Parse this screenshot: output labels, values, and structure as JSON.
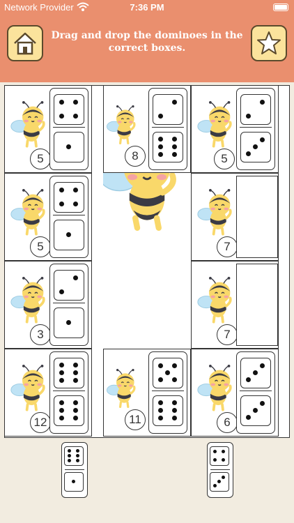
{
  "status_bar": {
    "carrier": "Network Provider",
    "time": "7:36 PM"
  },
  "header": {
    "instruction": "Drag and drop the dominoes in the correct boxes.",
    "home_icon": "home-icon",
    "star_icon": "star-icon",
    "colors": {
      "bar": "#ea8f6e",
      "button": "#fbe39c"
    }
  },
  "board": {
    "cells": [
      {
        "number": "5",
        "domino": [
          4,
          1
        ]
      },
      {
        "number": "8",
        "domino": [
          2,
          6
        ]
      },
      {
        "number": "5",
        "domino": [
          2,
          3
        ]
      },
      {
        "number": "5",
        "domino": [
          4,
          1
        ]
      },
      {
        "number": "7",
        "domino": null
      },
      {
        "number": "3",
        "domino": [
          2,
          1
        ]
      },
      {
        "number": "7",
        "domino": null
      },
      {
        "number": "12",
        "domino": [
          6,
          6
        ]
      },
      {
        "number": "11",
        "domino": [
          5,
          6
        ]
      },
      {
        "number": "6",
        "domino": [
          3,
          3
        ]
      }
    ]
  },
  "tray": [
    {
      "domino": [
        6,
        1
      ]
    },
    {
      "domino": [
        4,
        3
      ]
    }
  ]
}
